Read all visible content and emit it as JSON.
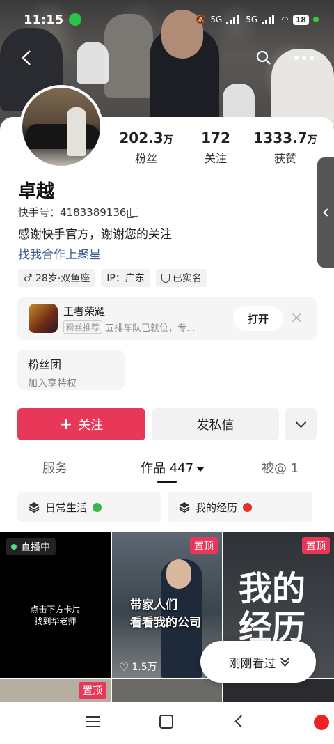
{
  "status_bar": {
    "time": "11:15",
    "signal1": "5G",
    "signal2": "5G",
    "battery": "18"
  },
  "profile": {
    "name": "卓越",
    "kuaishou_id": "快手号：4183389136",
    "bio": "感谢快手官方，谢谢您的关注",
    "collab_link": "找我合作上聚星",
    "stats": [
      {
        "num": "202.3",
        "unit": "万",
        "label": "粉丝"
      },
      {
        "num": "172",
        "unit": "",
        "label": "关注"
      },
      {
        "num": "1333.7",
        "unit": "万",
        "label": "获赞"
      }
    ],
    "tags": [
      "♂ 28岁·双鱼座",
      "IP：广东",
      "已实名"
    ]
  },
  "game_card": {
    "title": "王者荣耀",
    "badge": "粉丝推荐",
    "subtitle": "五排车队已就位，专...",
    "open_label": "打开",
    "close_icon": "×"
  },
  "fan_club": {
    "title": "粉丝团",
    "subtitle": "加入享特权"
  },
  "actions": {
    "follow_label": "关注",
    "message_label": "发私信"
  },
  "tabs": [
    {
      "label": "服务"
    },
    {
      "label": "作品 447"
    },
    {
      "label": "被@ 1"
    }
  ],
  "collections": [
    {
      "label": "日常生活"
    },
    {
      "label": "我的经历"
    }
  ],
  "videos": {
    "live_label": "直播中",
    "live_text_line1": "点击下方卡片",
    "live_text_line2": "找到华老师",
    "pin_label": "置顶",
    "video2_line1": "带家人们",
    "video2_line2": "看看我的公司",
    "video2_likes": "1.5万",
    "video3_line1": "我的",
    "video3_line2": "经历"
  },
  "just_watched": "刚刚看过",
  "colors": {
    "accent": "#e8385a",
    "link": "#3a5a94"
  }
}
